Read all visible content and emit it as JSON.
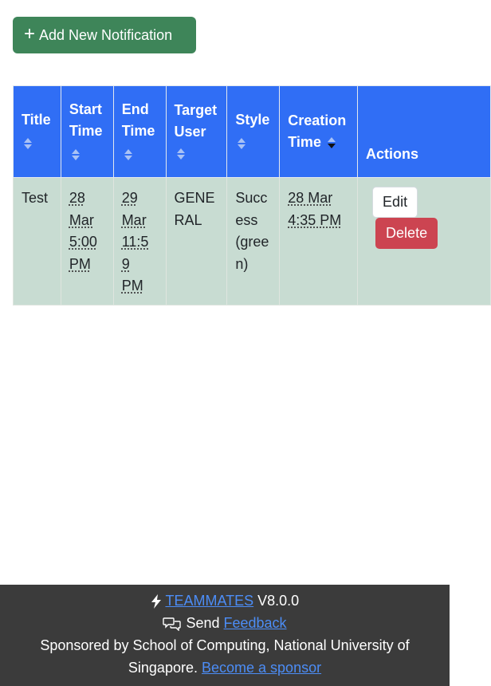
{
  "toolbar": {
    "add_label": "Add New Notification",
    "add_icon": "plus-icon"
  },
  "table": {
    "headers": {
      "title": "Title",
      "start_time": [
        "Start",
        "Time"
      ],
      "end_time": [
        "End",
        "Time"
      ],
      "target_user": [
        "Target",
        "User"
      ],
      "style": "Style",
      "creation_time": [
        "Creation",
        "Time"
      ],
      "actions": "Actions"
    },
    "rows": [
      {
        "title": "Test",
        "start_time": [
          "28",
          "Mar",
          "5:00",
          "PM"
        ],
        "end_time": [
          "29",
          "Mar",
          "11:5",
          "9",
          "PM"
        ],
        "target_user": [
          "GENE",
          "RAL"
        ],
        "style": [
          "Succ",
          "ess",
          "(gree",
          "n)"
        ],
        "creation_time": [
          "28 Mar",
          "4:35 PM"
        ],
        "edit_label": "Edit",
        "delete_label": "Delete"
      }
    ]
  },
  "footer": {
    "product": "TEAMMATES",
    "version": "V8.0.0",
    "send": "Send",
    "feedback": "Feedback",
    "sponsor_text": "Sponsored by School of Computing, National University of",
    "sponsor_text2": "Singapore.",
    "become_sponsor": "Become a sponsor"
  },
  "colors": {
    "primary": "#306ef5",
    "success": "#3e8559",
    "danger": "#cc4451",
    "row_bg": "#c8dcd2",
    "footer_bg": "#3b3b3b"
  }
}
